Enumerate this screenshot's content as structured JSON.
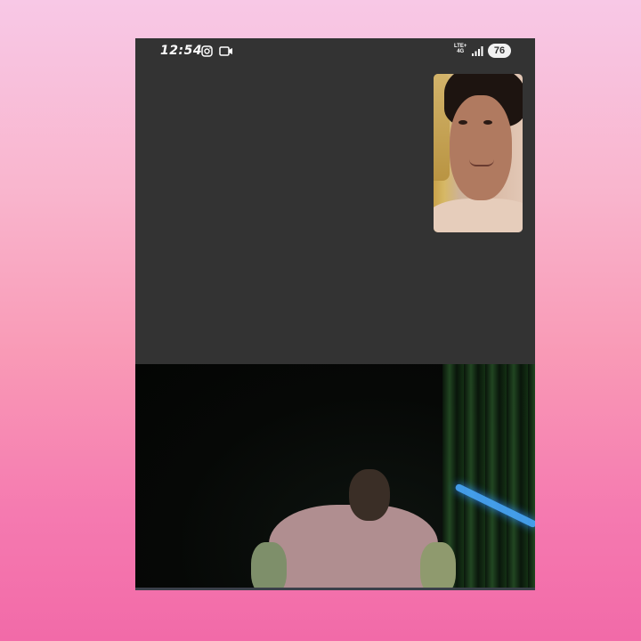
{
  "status_bar": {
    "time": "12:54",
    "notification_icons": [
      "instagram-icon",
      "video-call-icon"
    ],
    "network_label_top": "LTE+",
    "network_label_bottom": "4G",
    "signal_icon": "signal-bars-icon",
    "battery_level": "76"
  },
  "call": {
    "self_view": "front-camera-preview",
    "remote_view": "remote-video-feed"
  },
  "colors": {
    "screen_bg": "#333333",
    "background_gradient_top": "#f8c8e6",
    "background_gradient_bottom": "#f26aa8",
    "accent_glow": "#49a9ff"
  }
}
